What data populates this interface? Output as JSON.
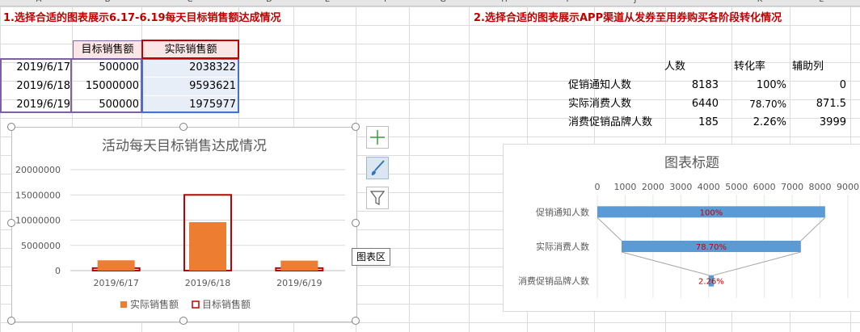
{
  "columns": [
    "A",
    "B",
    "C",
    "D",
    "E",
    "F",
    "G",
    "H",
    "I",
    "J",
    "K",
    "L"
  ],
  "task1_title": "1.选择合适的图表展示6.17-6.19每天目标销售额达成情况",
  "task2_title": "2.选择合适的图表展示APP渠道从发券至用券购买各阶段转化情况",
  "table1": {
    "headers": [
      "目标销售额",
      "实际销售额"
    ],
    "rows": [
      {
        "date": "2019/6/17",
        "target": "500000",
        "actual": "2038322"
      },
      {
        "date": "2019/6/18",
        "target": "15000000",
        "actual": "9593621"
      },
      {
        "date": "2019/6/19",
        "target": "500000",
        "actual": "1975977"
      }
    ]
  },
  "table2": {
    "headers": [
      "人数",
      "转化率",
      "辅助列"
    ],
    "rows": [
      {
        "label": "促销通知人数",
        "count": "8183",
        "rate": "100%",
        "helper": "0"
      },
      {
        "label": "实际消费人数",
        "count": "6440",
        "rate": "78.70%",
        "helper": "871.5"
      },
      {
        "label": "消费促销品牌人数",
        "count": "185",
        "rate": "2.26%",
        "helper": "3999"
      }
    ]
  },
  "tooltip": "图表区",
  "side_buttons": [
    "plus-icon",
    "brush-icon",
    "filter-icon"
  ],
  "chart_data": [
    {
      "type": "bar",
      "title": "活动每天目标销售达成情况",
      "categories": [
        "2019/6/17",
        "2019/6/18",
        "2019/6/19"
      ],
      "series": [
        {
          "name": "实际销售额",
          "values": [
            2038322,
            9593621,
            1975977
          ],
          "color": "#ed7d31"
        },
        {
          "name": "目标销售额",
          "values": [
            500000,
            15000000,
            500000
          ],
          "color": "#c00000",
          "style": "outline"
        }
      ],
      "y_ticks": [
        "0",
        "5000000",
        "10000000",
        "15000000",
        "20000000"
      ],
      "ylim": [
        0,
        20000000
      ],
      "grid": true,
      "legend": "bottom"
    },
    {
      "type": "bar",
      "title": "图表标题",
      "orientation": "horizontal-funnel",
      "categories": [
        "促销通知人数",
        "实际消费人数",
        "消费促销品牌人数"
      ],
      "values": [
        8183,
        6440,
        185
      ],
      "offsets": [
        0,
        871.5,
        3999
      ],
      "labels": [
        "100%",
        "78.70%",
        "2.26%"
      ],
      "x_ticks": [
        "0",
        "1000",
        "2000",
        "3000",
        "4000",
        "5000",
        "6000",
        "7000",
        "8000",
        "9000"
      ],
      "xlim": [
        0,
        9000
      ],
      "color": "#5b9bd5",
      "label_color": "#c00000"
    }
  ]
}
